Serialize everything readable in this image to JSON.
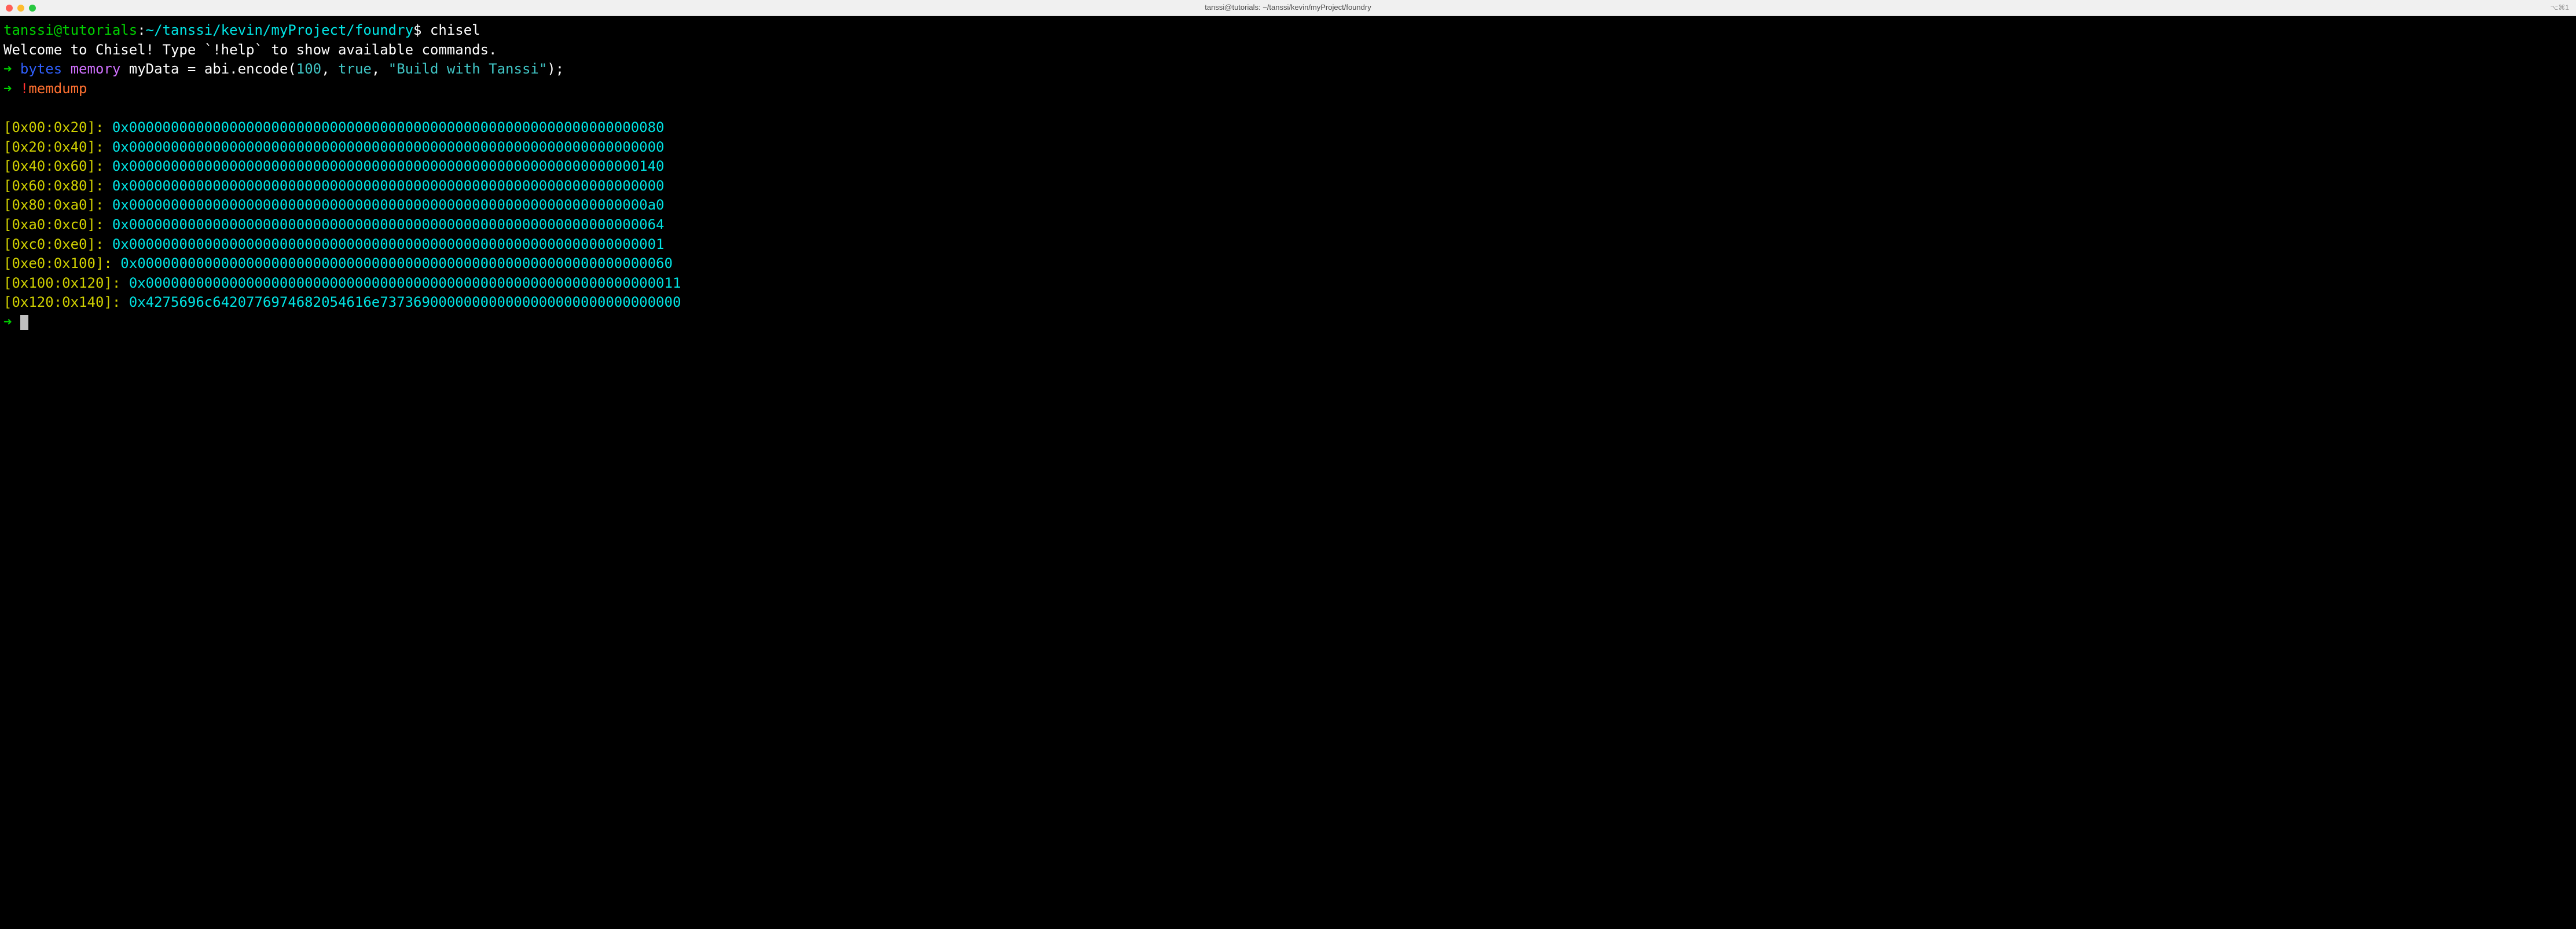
{
  "titlebar": {
    "title": "tanssi@tutorials: ~/tanssi/kevin/myProject/foundry",
    "right": "⌥⌘1"
  },
  "prompt": {
    "user": "tanssi@tutorials",
    "colon": ":",
    "path": "~/tanssi/kevin/myProject/foundry",
    "dollar": "$",
    "command": "chisel"
  },
  "welcome": "Welcome to Chisel! Type `!help` to show available commands.",
  "input1": {
    "arrow": "➜",
    "kw_bytes": "bytes",
    "kw_memory": "memory",
    "var": "myData",
    "eq": "=",
    "fn": "abi.encode(",
    "num": "100",
    "comma1": ",",
    "bool": "true",
    "comma2": ",",
    "str": "\"Build with Tanssi\"",
    "close": ");"
  },
  "input2": {
    "arrow": "➜",
    "bang": "!",
    "cmd": "memdump"
  },
  "memdump": [
    {
      "range": "[0x00:0x20]:",
      "hex": "0x0000000000000000000000000000000000000000000000000000000000000080"
    },
    {
      "range": "[0x20:0x40]:",
      "hex": "0x0000000000000000000000000000000000000000000000000000000000000000"
    },
    {
      "range": "[0x40:0x60]:",
      "hex": "0x0000000000000000000000000000000000000000000000000000000000000140"
    },
    {
      "range": "[0x60:0x80]:",
      "hex": "0x0000000000000000000000000000000000000000000000000000000000000000"
    },
    {
      "range": "[0x80:0xa0]:",
      "hex": "0x00000000000000000000000000000000000000000000000000000000000000a0"
    },
    {
      "range": "[0xa0:0xc0]:",
      "hex": "0x0000000000000000000000000000000000000000000000000000000000000064"
    },
    {
      "range": "[0xc0:0xe0]:",
      "hex": "0x0000000000000000000000000000000000000000000000000000000000000001"
    },
    {
      "range": "[0xe0:0x100]:",
      "hex": "0x0000000000000000000000000000000000000000000000000000000000000060"
    },
    {
      "range": "[0x100:0x120]:",
      "hex": "0x0000000000000000000000000000000000000000000000000000000000000011"
    },
    {
      "range": "[0x120:0x140]:",
      "hex": "0x4275696c6420776974682054616e737369000000000000000000000000000000"
    }
  ],
  "final": {
    "arrow": "➜"
  }
}
